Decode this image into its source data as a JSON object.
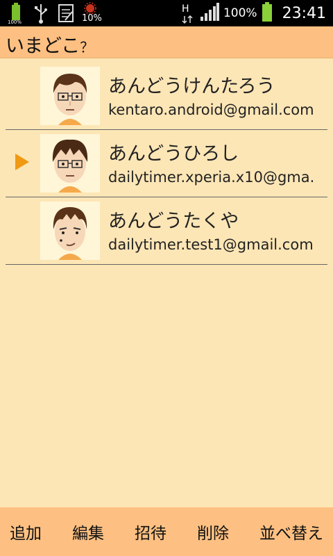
{
  "status_bar": {
    "left_icons": [
      "battery-100-icon",
      "usb-icon",
      "clipboard-icon",
      "virus-icon"
    ],
    "small_percent_label": "10%",
    "network_label": "H",
    "battery_percent": "100%",
    "time": "23:41"
  },
  "title_bar": {
    "title": "いまどこ",
    "title_suffix": "？"
  },
  "contacts": [
    {
      "name": "あんどうけんたろう",
      "email": "kentaro.android@gmail.com",
      "selected": false
    },
    {
      "name": "あんどうひろし",
      "email": "dailytimer.xperia.x10@gma.",
      "selected": true
    },
    {
      "name": "あんどうたくや",
      "email": "dailytimer.test1@gmail.com",
      "selected": false
    }
  ],
  "toolbar": {
    "add": "追加",
    "edit": "編集",
    "invite": "招待",
    "delete": "削除",
    "sort": "並べ替え"
  },
  "colors": {
    "background": "#fde6b6",
    "title_bar": "#fdc082",
    "selection_marker": "#ef9a12",
    "battery": "#8bd13a"
  }
}
